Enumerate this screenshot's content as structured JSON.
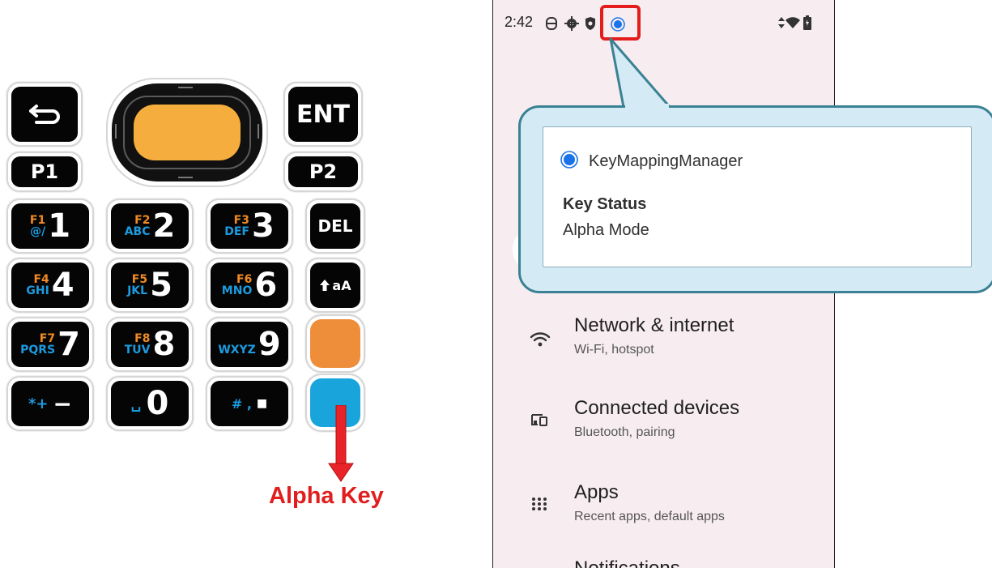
{
  "keypad": {
    "back_icon": "back-arrow-icon",
    "ent": "ENT",
    "p1": "P1",
    "p2": "P2",
    "del": "DEL",
    "shift_text": "aA",
    "keys": [
      {
        "fn": "F1",
        "letters": "@/",
        "num": "1"
      },
      {
        "fn": "F2",
        "letters": "ABC",
        "num": "2"
      },
      {
        "fn": "F3",
        "letters": "DEF",
        "num": "3"
      },
      {
        "fn": "F4",
        "letters": "GHI",
        "num": "4"
      },
      {
        "fn": "F5",
        "letters": "JKL",
        "num": "5"
      },
      {
        "fn": "F6",
        "letters": "MNO",
        "num": "6"
      },
      {
        "fn": "F7",
        "letters": "PQRS",
        "num": "7"
      },
      {
        "fn": "F8",
        "letters": "TUV",
        "num": "8"
      },
      {
        "fn": "",
        "letters": "WXYZ",
        "num": "9"
      }
    ],
    "bottom": {
      "k1_sym": "*+",
      "k1_main": "−",
      "k2_sym": "␣",
      "k2_main": "0",
      "k3_sym": "# ,",
      "k3_main": "■"
    },
    "colors": {
      "scan": "#f5ad3d",
      "orange_key": "#ee8d3a",
      "blue_key": "#19a5dc",
      "arrow": "#e8242a"
    }
  },
  "annotation": {
    "alpha_label": "Alpha Key"
  },
  "phone": {
    "status_time": "2:42",
    "notification": {
      "app_name": "KeyMappingManager",
      "title": "Key Status",
      "text": "Alpha Mode"
    },
    "settings": [
      {
        "icon": "wifi-icon",
        "title": "Network & internet",
        "subtitle": "Wi-Fi, hotspot"
      },
      {
        "icon": "connected-devices-icon",
        "title": "Connected devices",
        "subtitle": "Bluetooth, pairing"
      },
      {
        "icon": "apps-icon",
        "title": "Apps",
        "subtitle": "Recent apps, default apps"
      },
      {
        "icon": "",
        "title": "Notifications",
        "subtitle": ""
      }
    ]
  }
}
